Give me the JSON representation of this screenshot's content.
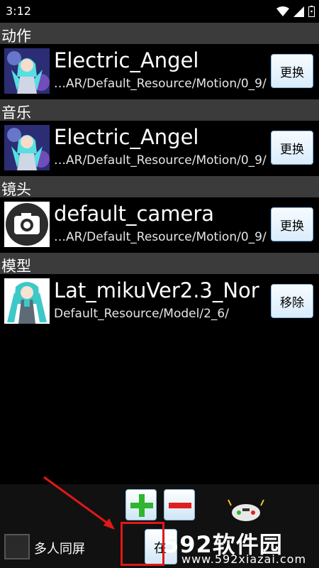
{
  "status": {
    "time": "3:12"
  },
  "sections": [
    {
      "header": "动作",
      "name": "Electric_Angel",
      "path": "…AR/Default_Resource/Motion/0_9/",
      "button": "更换",
      "thumb": "miku-angel"
    },
    {
      "header": "音乐",
      "name": "Electric_Angel",
      "path": "…AR/Default_Resource/Motion/0_9/",
      "button": "更换",
      "thumb": "miku-angel"
    },
    {
      "header": "镜头",
      "name": "default_camera",
      "path": "…AR/Default_Resource/Motion/0_9/",
      "button": "更换",
      "thumb": "camera-icon"
    },
    {
      "header": "模型",
      "name": "Lat_mikuVer2.3_Nor",
      "path": "Default_Resource/Model/2_6/",
      "button": "移除",
      "thumb": "miku-model"
    }
  ],
  "bottom": {
    "multi_screen_label": "多人同屏",
    "start_button_label": "在",
    "plus_icon": "plus-icon",
    "minus_icon": "minus-icon"
  },
  "watermark": {
    "brand": "592软件园",
    "url": "www.592xiazai.com"
  },
  "colors": {
    "header_bg": "#3b3b3b",
    "highlight": "#e01818",
    "plus": "#2fb52f",
    "minus": "#e02020"
  }
}
